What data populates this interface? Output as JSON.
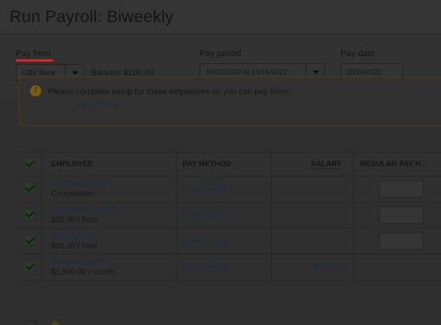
{
  "page": {
    "title": "Run Payroll: Biweekly"
  },
  "pay_from": {
    "label": "Pay from",
    "account": "GBP Bank",
    "balance": "Balance $100.00"
  },
  "pay_period": {
    "label": "Pay period",
    "value": "10/02/2022 to 10/15/2022"
  },
  "pay_date": {
    "label": "Pay date",
    "value": "10/14/2022"
  },
  "warning": {
    "message": "Please complete setup for these employees so you can pay them:",
    "employee_link": "Imani Talley"
  },
  "table": {
    "headers": {
      "employee": "EMPLOYEE",
      "pay_method": "PAY METHOD",
      "salary": "SALARY",
      "regular_pay": "REGULAR PAY H..."
    },
    "rows": [
      {
        "name": "Fullbuster, Gray",
        "rate": "Commission",
        "pay_method": "Paper check",
        "salary": "",
        "checked": true
      },
      {
        "name": "Lumongtad, Juviel",
        "rate": "$20.00 / hour",
        "pay_method": "Paper check",
        "salary": "",
        "checked": true
      },
      {
        "name": "Roca, Mark c",
        "rate": "$50.00 / hour",
        "pay_method": "Paper check",
        "salary": "",
        "checked": true
      },
      {
        "name": "Strawhat, Luffy",
        "rate": "$1,500.00 / month",
        "pay_method": "Paper check",
        "salary": "$692.31",
        "checked": true
      }
    ]
  },
  "colors": {
    "overlay": "#2e2e2e",
    "accent_underline": "#d8242b",
    "link": "#1d2a46",
    "check": "#2e3a2c"
  }
}
